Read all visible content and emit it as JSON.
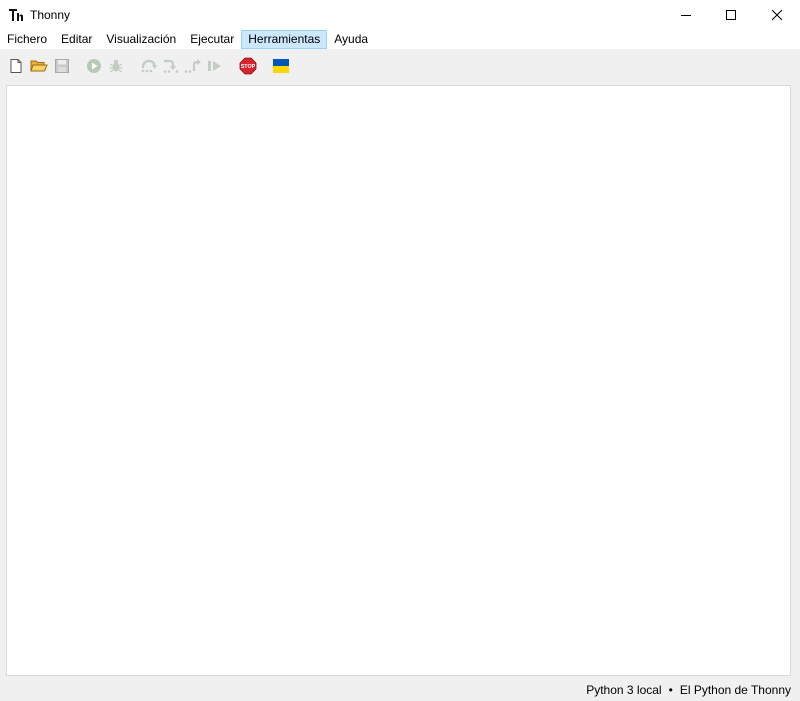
{
  "window": {
    "title": "Thonny",
    "app_icon": "thonny-logo-icon",
    "controls": [
      "minimize-icon",
      "maximize-icon",
      "close-icon"
    ]
  },
  "menu": {
    "items": [
      {
        "label": "Fichero"
      },
      {
        "label": "Editar"
      },
      {
        "label": "Visualización"
      },
      {
        "label": "Ejecutar"
      },
      {
        "label": "Herramientas",
        "active": true
      },
      {
        "label": "Ayuda"
      }
    ]
  },
  "toolbar": {
    "buttons": [
      {
        "icon": "new-file-icon",
        "enabled": true
      },
      {
        "icon": "open-folder-icon",
        "enabled": true
      },
      {
        "icon": "save-icon",
        "enabled": false
      },
      {
        "icon": "run-icon",
        "enabled": false
      },
      {
        "icon": "debug-icon",
        "enabled": false
      },
      {
        "icon": "step-over-icon",
        "enabled": false
      },
      {
        "icon": "step-into-icon",
        "enabled": false
      },
      {
        "icon": "step-out-icon",
        "enabled": false
      },
      {
        "icon": "resume-icon",
        "enabled": false
      },
      {
        "icon": "stop-icon",
        "enabled": true,
        "text": "STOP"
      },
      {
        "icon": "ukraine-flag-icon",
        "enabled": true
      }
    ]
  },
  "status": {
    "interpreter": "Python 3 local",
    "separator": "•",
    "environment": "El Python de Thonny"
  },
  "colors": {
    "menu_active_bg": "#cce8ff",
    "stop_red": "#d9232e",
    "flag_blue": "#0057b7",
    "flag_yellow": "#ffd700",
    "disabled_gray": "#b9c4b9"
  }
}
